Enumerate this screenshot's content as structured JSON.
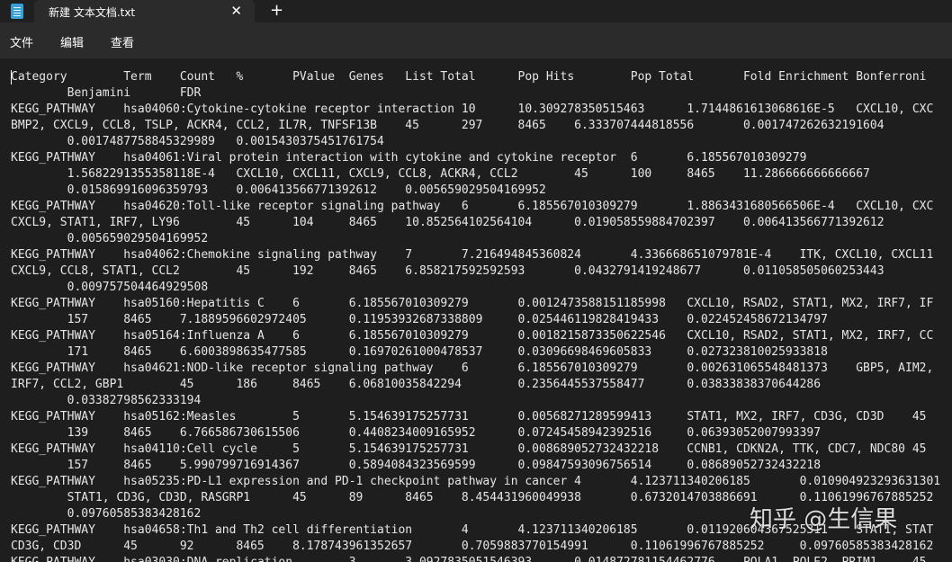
{
  "window": {
    "tab_title": "新建 文本文档.txt",
    "close_glyph": "✕",
    "new_tab_glyph": "+"
  },
  "menu": {
    "file": "文件",
    "edit": "编辑",
    "view": "查看"
  },
  "document": {
    "lines": [
      "Category\tTerm\tCount\t%\tPValue\tGenes\tList Total\tPop Hits\tPop Total\tFold Enrichment\tBonferroni",
      "\tBenjamini\tFDR",
      "KEGG_PATHWAY\thsa04060:Cytokine-cytokine receptor interaction\t10\t10.309278350515463\t1.7144861613068616E-5\tCXCL10, CXC",
      "BMP2, CXCL9, CCL8, TSLP, ACKR4, CCL2, IL7R, TNFSF13B\t45\t297\t8465\t6.333707444818556\t0.001747262632191604",
      "\t0.0017487758845329989\t0.0015430375451761754",
      "KEGG_PATHWAY\thsa04061:Viral protein interaction with cytokine and cytokine receptor\t6\t6.185567010309279",
      "\t1.5682291355358118E-4\tCXCL10, CXCL11, CXCL9, CCL8, ACKR4, CCL2\t45\t100\t8465\t11.286666666666667",
      "\t0.015869916096359793\t0.006413566771392612\t0.005659029504169952",
      "KEGG_PATHWAY\thsa04620:Toll-like receptor signaling pathway\t6\t6.185567010309279\t1.8863431680566506E-4\tCXCL10, CXC",
      "CXCL9, STAT1, IRF7, LY96\t45\t104\t8465\t10.852564102564104\t0.019058559884702397\t0.006413566771392612",
      "\t0.005659029504169952",
      "KEGG_PATHWAY\thsa04062:Chemokine signaling pathway\t7\t7.216494845360824\t4.336668651079781E-4\tITK, CXCL10, CXCL11",
      "CXCL9, CCL8, STAT1, CCL2\t45\t192\t8465\t6.858217592592593\t0.0432791419248677\t0.011058505060253443",
      "\t0.009757504464929508",
      "KEGG_PATHWAY\thsa05160:Hepatitis C\t6\t6.185567010309279\t0.0012473588151185998\tCXCL10, RSAD2, STAT1, MX2, IRF7, IF",
      "\t157\t8465\t7.1889596602972405\t0.11953932687338809\t0.025446119828419433\t0.022452458672134797",
      "KEGG_PATHWAY\thsa05164:Influenza A\t6\t6.185567010309279\t0.0018215873350622546\tCXCL10, RSAD2, STAT1, MX2, IRF7, CC",
      "\t171\t8465\t6.6003898635477585\t0.16970261000478537\t0.03096698469605833\t0.027323810025933818",
      "KEGG_PATHWAY\thsa04621:NOD-like receptor signaling pathway\t6\t6.185567010309279\t0.002631065548481373\tGBP5, AIM2,",
      "IRF7, CCL2, GBP1\t45\t186\t8465\t6.06810035842294\t0.2356445537558477\t0.03833838370644286",
      "\t0.03382798562333194",
      "KEGG_PATHWAY\thsa05162:Measles\t5\t5.154639175257731\t0.00568271289599413\tSTAT1, MX2, IRF7, CD3G, CD3D\t45",
      "\t139\t8465\t6.766586730615506\t0.4408234009165952\t0.07245458942392516\t0.06393052007993397",
      "KEGG_PATHWAY\thsa04110:Cell cycle\t5\t5.154639175257731\t0.008689052732432218\tCCNB1, CDKN2A, TTK, CDC7, NDC80 45",
      "\t157\t8465\t5.990799716914367\t0.5894084323569599\t0.09847593096756514\t0.08689052732432218",
      "KEGG_PATHWAY\thsa05235:PD-L1 expression and PD-1 checkpoint pathway in cancer 4\t4.123711340206185\t0.010904923293631301",
      "\tSTAT1, CD3G, CD3D, RASGRP1\t45\t89\t8465\t8.454431960049938\t0.6732014703886691\t0.11061996767885252",
      "\t0.09760585383428162",
      "KEGG_PATHWAY\thsa04658:Th1 and Th2 cell differentiation\t4\t4.123711340206185\t0.011920604367525311\tSTAT1, STAT",
      "CD3G, CD3D\t45\t92\t8465\t8.178743961352657\t0.7059883770154991\t0.11061996767885252\t0.09760585383428162",
      "KEGG_PATHWAY\thsa03030:DNA replication\t3\t3.0927835051546393\t0.014872781154462776\tPOLA1, POLE2, PRIM1\t45"
    ]
  },
  "watermark": "知乎 @生信果"
}
